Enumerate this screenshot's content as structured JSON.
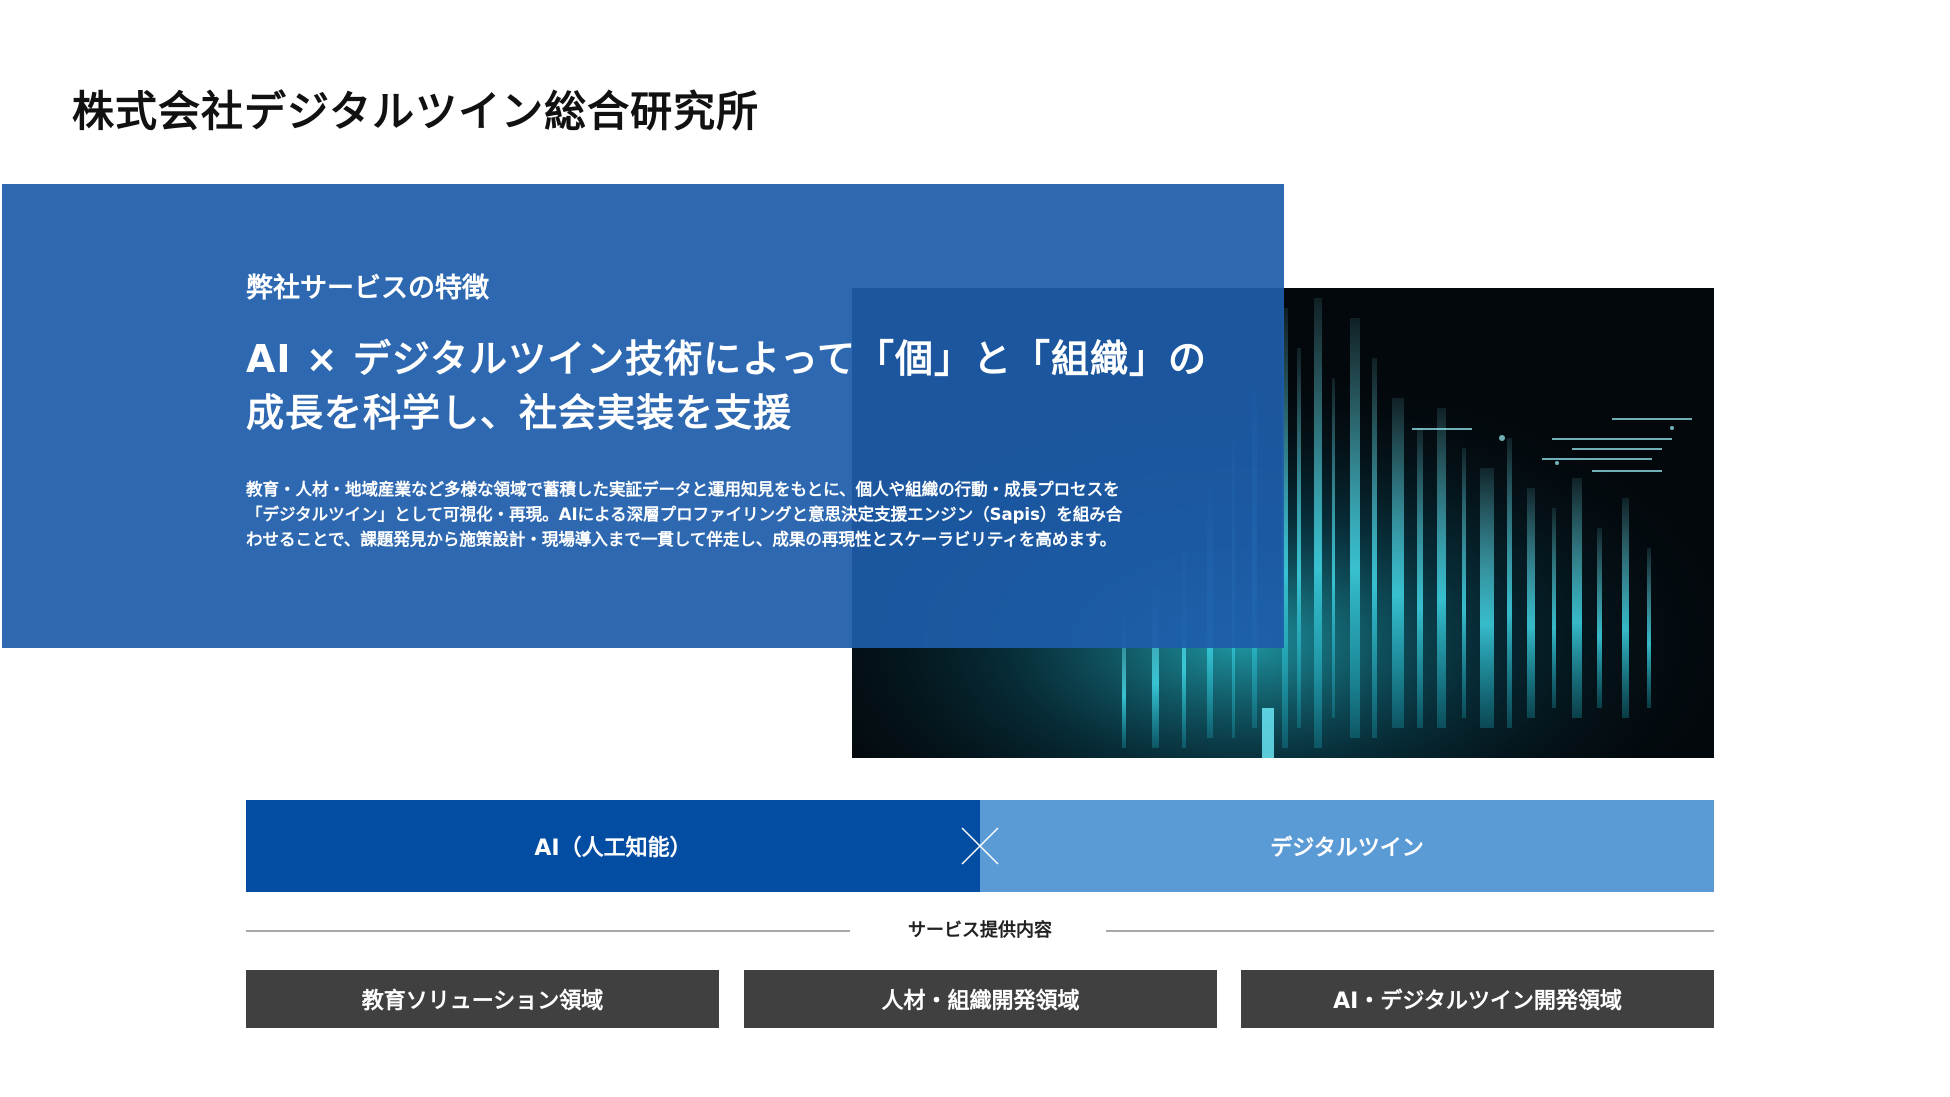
{
  "header": {
    "company_name": "株式会社デジタルツイン総合研究所"
  },
  "feature": {
    "kicker": "弊社サービスの特徴",
    "headline_lines": [
      "AI × デジタルツイン技術によって「個」と「組織」の",
      "成長を科学し、社会実装を支援"
    ],
    "body_lines": [
      "教育・人材・地域産業など多様な領域で蓄積した実証データと運用知見をもとに、個人や組織の行動・成長プロセスを",
      "「デジタルツイン」として可視化・再現。AIによる深層プロファイリングと意思決定支援エンジン（Sapis）を組み合",
      "わせることで、課題発見から施策設計・現場導入まで一貫して伴走し、成果の再現性とスケーラビリティを高めます。"
    ]
  },
  "hero_image": {
    "icon": "digital-data-visualization-image"
  },
  "combination": {
    "left_label": "AI（人工知能）",
    "right_label": "デジタルツイン",
    "left_color": "#034ea2",
    "right_color": "#5b9bd5"
  },
  "services": {
    "section_label": "サービス提供内容",
    "items": [
      {
        "label": "教育ソリューション領域"
      },
      {
        "label": "人材・組織開発領域"
      },
      {
        "label": "AI・デジタルツイン開発領域"
      }
    ]
  },
  "colors": {
    "panel_blue": "#1d5caa",
    "button_gray": "#404040",
    "divider_gray": "#a8a8a8"
  }
}
